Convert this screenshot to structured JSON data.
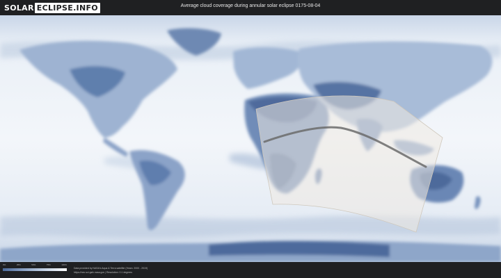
{
  "header": {
    "logo_part1": "SOLAR",
    "logo_part2": "ECLIPSE.INFO",
    "title": "Average cloud coverage during annular solar eclipse 0175-08-04"
  },
  "legend": {
    "labels": [
      "0%",
      "25%",
      "50%",
      "75%",
      "100%"
    ],
    "colors": [
      "#4d6b9b",
      "#8da4c6",
      "#c8d6e8",
      "#ffffff"
    ]
  },
  "credits": {
    "line1": "Data provided by NASA's Aqua & Terra satellite (Years: 2000 - 2019)",
    "line2": "https://neo.sci.gsfc.nasa.gov | Resolution: 0.1 degrees"
  },
  "map": {
    "colors": {
      "ocean_clear": "#eef3f9",
      "land_clear": "#6f8db8",
      "land_medium": "#a9bdd8",
      "eclipse_zone": "#ece7df",
      "path": "#6b6b6b"
    }
  }
}
